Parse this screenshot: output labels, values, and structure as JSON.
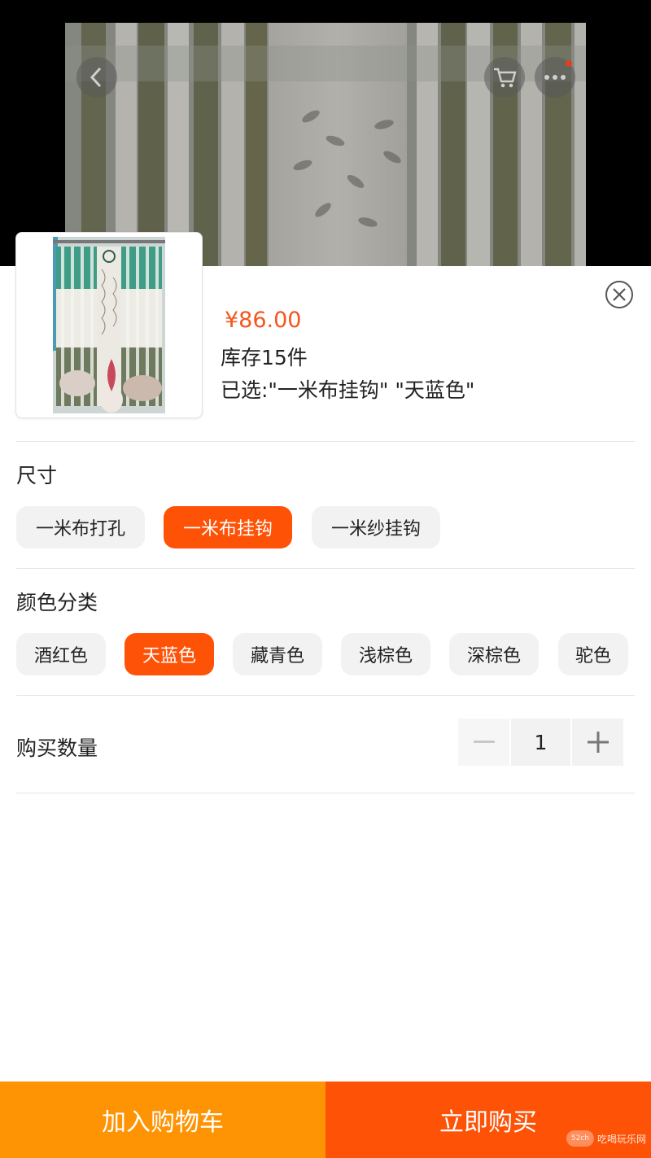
{
  "product": {
    "price": "¥86.00",
    "stock": "库存15件",
    "selected": "已选:\"一米布挂钩\" \"天蓝色\""
  },
  "size_section": {
    "title": "尺寸",
    "options": [
      "一米布打孔",
      "一米布挂钩",
      "一米纱挂钩"
    ],
    "selected_index": 1
  },
  "color_section": {
    "title": "颜色分类",
    "options": [
      "酒红色",
      "天蓝色",
      "藏青色",
      "浅棕色",
      "深棕色",
      "驼色"
    ],
    "selected_index": 1
  },
  "quantity": {
    "label": "购买数量",
    "value": "1",
    "minus": "−",
    "plus": "+"
  },
  "actions": {
    "add_to_cart": "加入购物车",
    "buy_now": "立即购买"
  },
  "colors": {
    "accent": "#fe5206",
    "cart_button": "#fe9303",
    "buy_button": "#fe5206",
    "price": "#f4561e"
  },
  "icons": [
    "back-icon",
    "cart-icon",
    "more-icon",
    "close-icon",
    "minus-icon",
    "plus-icon"
  ],
  "watermark": "吃喝玩乐网"
}
